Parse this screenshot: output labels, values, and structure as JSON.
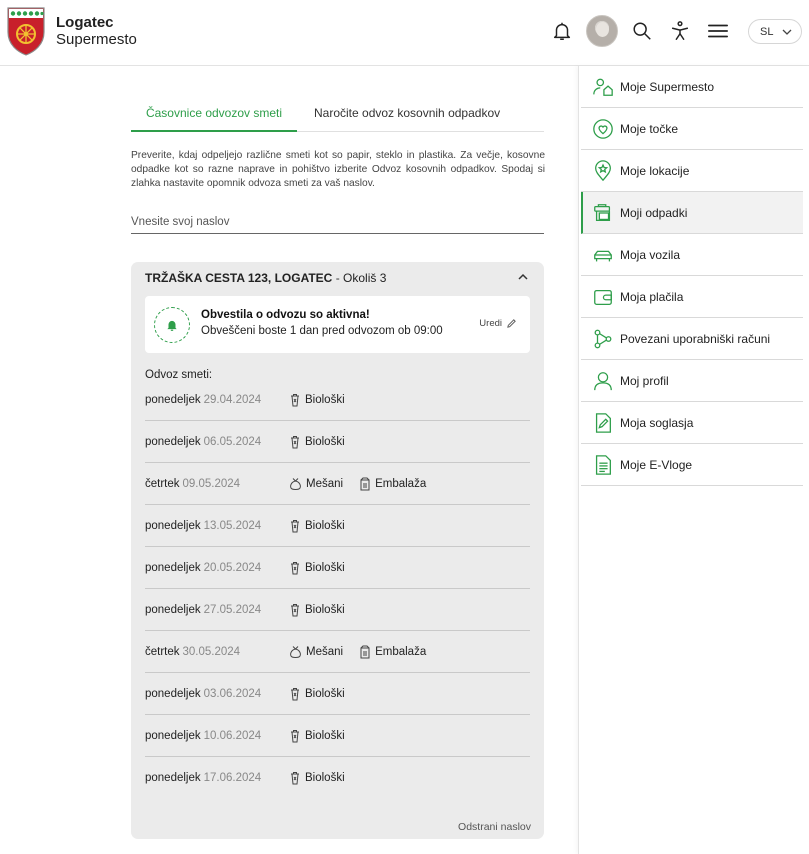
{
  "header": {
    "city": "Logatec",
    "app_name": "Supermesto",
    "icons": [
      "bell-icon",
      "avatar",
      "search-icon",
      "accessibility-icon",
      "menu-icon"
    ],
    "language": "SL"
  },
  "tabs": [
    {
      "label": "Časovnice odvozov smeti",
      "active": true
    },
    {
      "label": "Naročite odvoz kosovnih odpadkov",
      "active": false
    }
  ],
  "intro": "Preverite, kdaj odpeljejo različne smeti kot so papir, steklo in plastika. Za večje, kosovne odpadke kot so razne naprave in pohištvo izberite Odvoz kosovnih odpadkov. Spodaj si zlahka nastavite opomnik odvoza smeti za vaš naslov.",
  "address_input": {
    "placeholder": "Vnesite svoj naslov",
    "value": ""
  },
  "card": {
    "address": "TRŽAŠKA CESTA 123, LOGATEC",
    "separator": " - ",
    "district": "Okoliš 3",
    "notification": {
      "title": "Obvestila o odvozu so aktivna!",
      "subtitle": "Obveščeni boste 1 dan pred odvozom ob 09:00",
      "edit_label": "Uredi"
    },
    "schedule_label": "Odvoz smeti:",
    "schedule": [
      {
        "day": "ponedeljek",
        "date": "29.04.2024",
        "types": [
          "Biološki"
        ]
      },
      {
        "day": "ponedeljek",
        "date": "06.05.2024",
        "types": [
          "Biološki"
        ]
      },
      {
        "day": "četrtek",
        "date": "09.05.2024",
        "types": [
          "Mešani",
          "Embalaža"
        ]
      },
      {
        "day": "ponedeljek",
        "date": "13.05.2024",
        "types": [
          "Biološki"
        ]
      },
      {
        "day": "ponedeljek",
        "date": "20.05.2024",
        "types": [
          "Biološki"
        ]
      },
      {
        "day": "ponedeljek",
        "date": "27.05.2024",
        "types": [
          "Biološki"
        ]
      },
      {
        "day": "četrtek",
        "date": "30.05.2024",
        "types": [
          "Mešani",
          "Embalaža"
        ]
      },
      {
        "day": "ponedeljek",
        "date": "03.06.2024",
        "types": [
          "Biološki"
        ]
      },
      {
        "day": "ponedeljek",
        "date": "10.06.2024",
        "types": [
          "Biološki"
        ]
      },
      {
        "day": "ponedeljek",
        "date": "17.06.2024",
        "types": [
          "Biološki"
        ]
      }
    ],
    "remove_label": "Odstrani naslov"
  },
  "sidebar": {
    "items": [
      {
        "label": "Moje Supermesto",
        "icon": "user-home-icon",
        "active": false
      },
      {
        "label": "Moje točke",
        "icon": "heart-icon",
        "active": false
      },
      {
        "label": "Moje lokacije",
        "icon": "location-star-icon",
        "active": false
      },
      {
        "label": "Moji odpadki",
        "icon": "waste-bin-icon",
        "active": true
      },
      {
        "label": "Moja vozila",
        "icon": "car-icon",
        "active": false
      },
      {
        "label": "Moja plačila",
        "icon": "wallet-icon",
        "active": false
      },
      {
        "label": "Povezani uporabniški računi",
        "icon": "linked-accounts-icon",
        "active": false
      },
      {
        "label": "Moj profil",
        "icon": "user-icon",
        "active": false
      },
      {
        "label": "Moja soglasja",
        "icon": "document-edit-icon",
        "active": false
      },
      {
        "label": "Moje E-Vloge",
        "icon": "document-lines-icon",
        "active": false
      }
    ]
  },
  "colors": {
    "accent": "#2e9e4a",
    "card_bg": "#ebebeb",
    "date_grey": "#888888"
  }
}
